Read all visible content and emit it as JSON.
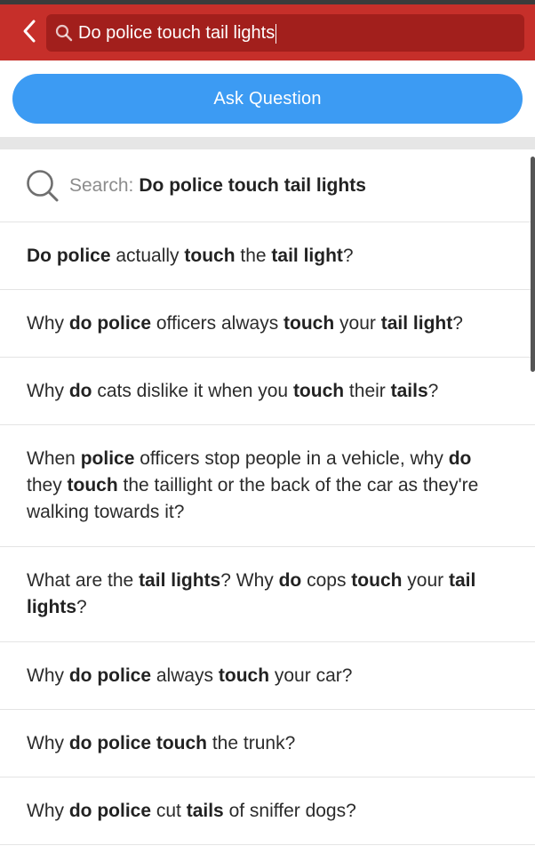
{
  "header": {
    "search_value": "Do police touch tail lights",
    "back_icon": "chevron-left-icon",
    "search_icon": "search-icon"
  },
  "ask_button": {
    "label": "Ask Question"
  },
  "search_suggestion": {
    "prefix": "Search:",
    "query": "Do police touch tail lights"
  },
  "results": [
    {
      "segments": [
        [
          "Do police",
          true
        ],
        [
          " actually ",
          false
        ],
        [
          "touch",
          true
        ],
        [
          " the ",
          false
        ],
        [
          "tail light",
          true
        ],
        [
          "?",
          false
        ]
      ]
    },
    {
      "segments": [
        [
          "Why ",
          false
        ],
        [
          "do police",
          true
        ],
        [
          " officers always ",
          false
        ],
        [
          "touch",
          true
        ],
        [
          " your ",
          false
        ],
        [
          "tail light",
          true
        ],
        [
          "?",
          false
        ]
      ]
    },
    {
      "segments": [
        [
          "Why ",
          false
        ],
        [
          "do",
          true
        ],
        [
          " cats dislike it when you ",
          false
        ],
        [
          "touch",
          true
        ],
        [
          " their ",
          false
        ],
        [
          "tails",
          true
        ],
        [
          "?",
          false
        ]
      ]
    },
    {
      "segments": [
        [
          "When ",
          false
        ],
        [
          "police",
          true
        ],
        [
          " officers stop people in a vehicle, why ",
          false
        ],
        [
          "do",
          true
        ],
        [
          " they ",
          false
        ],
        [
          "touch",
          true
        ],
        [
          " the taillight or the back of the car as they're walking towards it?",
          false
        ]
      ]
    },
    {
      "segments": [
        [
          "What are the ",
          false
        ],
        [
          "tail lights",
          true
        ],
        [
          "? Why ",
          false
        ],
        [
          "do",
          true
        ],
        [
          " cops ",
          false
        ],
        [
          "touch",
          true
        ],
        [
          " your ",
          false
        ],
        [
          "tail lights",
          true
        ],
        [
          "?",
          false
        ]
      ]
    },
    {
      "segments": [
        [
          "Why ",
          false
        ],
        [
          "do police",
          true
        ],
        [
          " always ",
          false
        ],
        [
          "touch",
          true
        ],
        [
          " your car?",
          false
        ]
      ]
    },
    {
      "segments": [
        [
          "Why ",
          false
        ],
        [
          "do police touch",
          true
        ],
        [
          " the trunk?",
          false
        ]
      ]
    },
    {
      "segments": [
        [
          "Why ",
          false
        ],
        [
          "do police",
          true
        ],
        [
          " cut ",
          false
        ],
        [
          "tails",
          true
        ],
        [
          " of sniffer dogs?",
          false
        ]
      ]
    }
  ],
  "colors": {
    "header_bg": "#c62f2a",
    "search_bg": "#a21f1c",
    "accent_blue": "#3c9bf3"
  }
}
